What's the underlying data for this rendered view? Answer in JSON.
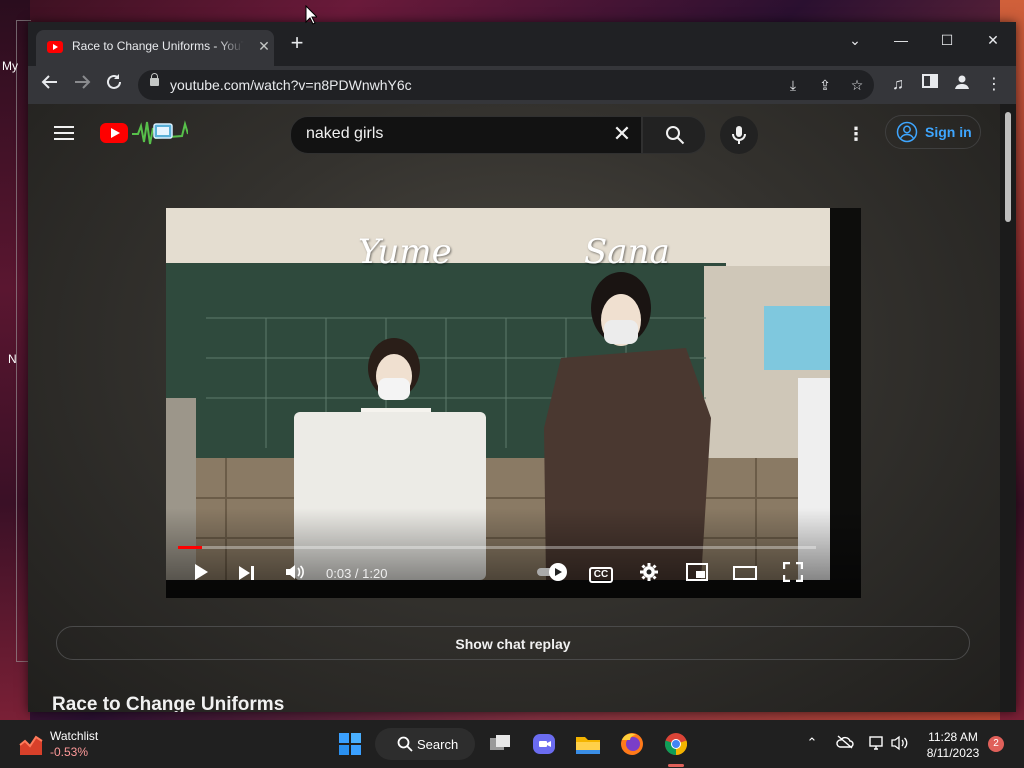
{
  "desktop": {
    "label_1": "My",
    "label_2": "N"
  },
  "browser": {
    "tab": {
      "title": "Race to Change Uniforms - YouTube"
    },
    "window_controls": {
      "dropdown": "⌄",
      "minimize": "—",
      "maximize": "☐",
      "close": "✕"
    },
    "address_bar": {
      "url": "youtube.com/watch?v=n8PDWnwhY6c"
    }
  },
  "youtube": {
    "search": {
      "query": "naked girls",
      "clear": "✕"
    },
    "more_icon": "⋮",
    "sign_in_label": "Sign in",
    "video": {
      "overlay_names": [
        "Yume",
        "Sana"
      ],
      "time_display": "0:03 / 1:20",
      "progress_fraction": 0.0375,
      "cc_label": "CC"
    },
    "show_chat_replay_label": "Show chat replay",
    "video_title": "Race to Change Uniforms"
  },
  "taskbar": {
    "widget": {
      "name": "Watchlist",
      "value": "-0.53%"
    },
    "search_label": "Search",
    "clock": {
      "time": "11:28 AM",
      "date": "8/11/2023"
    },
    "notification_count": "2"
  },
  "colors": {
    "youtube_red": "#ff0000",
    "sign_in_blue": "#3ea6ff",
    "browser_chrome": "#35363a",
    "taskbar": "#202020"
  }
}
